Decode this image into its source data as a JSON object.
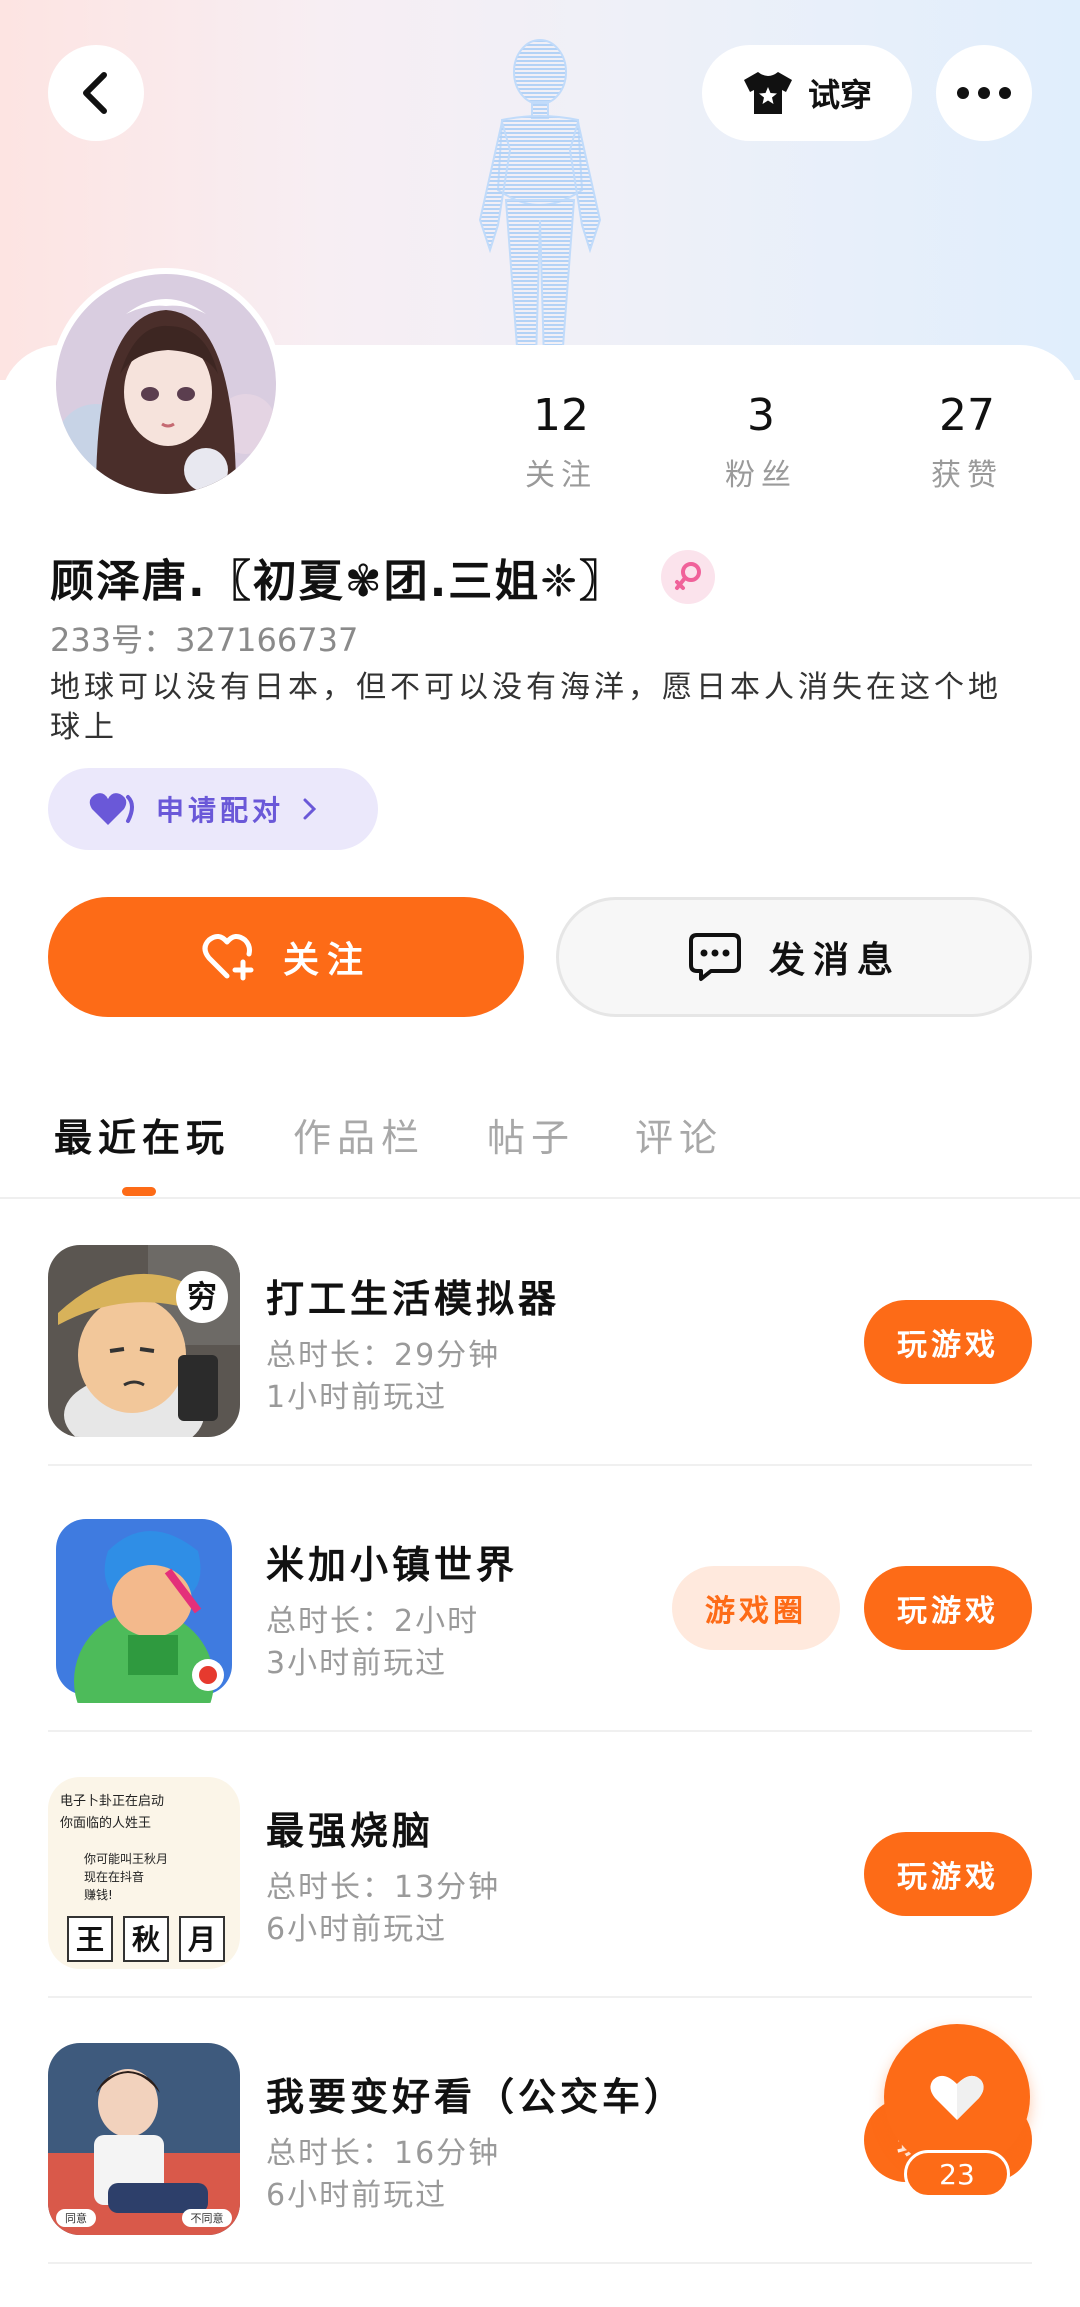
{
  "header": {
    "tryon_label": "试穿"
  },
  "stats": [
    {
      "value": "12",
      "label": "关注"
    },
    {
      "value": "3",
      "label": "粉丝"
    },
    {
      "value": "27",
      "label": "获赞"
    }
  ],
  "profile": {
    "name": "顾泽唐.〖初夏✾团.三姐❈〗",
    "uid": "233号：327166737",
    "bio": "地球可以没有日本，但不可以没有海洋，愿日本人消失在这个地球上",
    "pair_label": "申请配对"
  },
  "actions": {
    "follow_label": "关注",
    "message_label": "发消息"
  },
  "tabs": [
    "最近在玩",
    "作品栏",
    "帖子",
    "评论"
  ],
  "games": [
    {
      "title": "打工生活模拟器",
      "duration": "总时长：29分钟",
      "last_played": "1小时前玩过",
      "play_label": "玩游戏"
    },
    {
      "title": "米加小镇世界",
      "duration": "总时长：2小时",
      "last_played": "3小时前玩过",
      "circle_label": "游戏圈",
      "play_label": "玩游戏"
    },
    {
      "title": "最强烧脑",
      "duration": "总时长：13分钟",
      "last_played": "6小时前玩过",
      "play_label": "玩游戏"
    },
    {
      "title": "我要变好看（公交车）",
      "duration": "总时长：16分钟",
      "last_played": "6小时前玩过",
      "play_label": "玩游戏"
    }
  ],
  "thumb_text": {
    "g1_badge": "穷",
    "g3_lines": [
      "电子卜卦正在启动",
      "你面临的人姓王",
      "你可能叫王秋月",
      "现在在抖音",
      "赚钱!"
    ],
    "g3_chars": [
      "王",
      "秋",
      "月"
    ],
    "g4_labels": [
      "同意",
      "不同意"
    ]
  },
  "floating": {
    "like_count": "23"
  },
  "colors": {
    "accent": "#fd6b17",
    "pair_purple": "#6a58d8"
  }
}
